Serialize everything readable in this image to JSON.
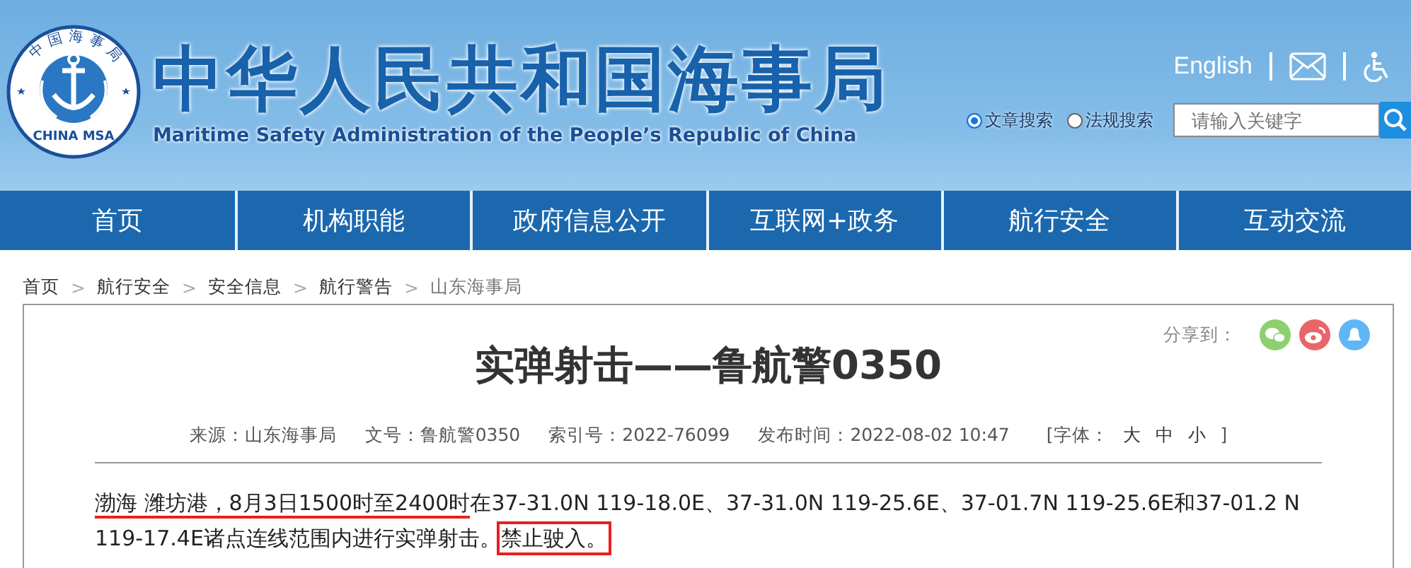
{
  "header": {
    "logo": {
      "ring_text": "中国海事局",
      "bottom_text": "CHINA MSA"
    },
    "title": "中华人民共和国海事局",
    "subtitle": "Maritime Safety Administration of the People’s Republic of China",
    "language_link": "English",
    "search_scopes": [
      {
        "label": "文章搜索",
        "selected": true
      },
      {
        "label": "法规搜索",
        "selected": false
      }
    ],
    "search": {
      "placeholder": "请输入关键字"
    }
  },
  "nav": [
    "首页",
    "机构职能",
    "政府信息公开",
    "互联网+政务",
    "航行安全",
    "互动交流"
  ],
  "breadcrumb": {
    "separator": ">",
    "items": [
      {
        "label": "首页",
        "current": false
      },
      {
        "label": "航行安全",
        "current": false
      },
      {
        "label": "安全信息",
        "current": false
      },
      {
        "label": "航行警告",
        "current": false
      },
      {
        "label": "山东海事局",
        "current": true
      }
    ]
  },
  "article": {
    "share_label": "分享到：",
    "title": "实弹射击——鲁航警0350",
    "meta": [
      "来源：山东海事局",
      "文号：鲁航警0350",
      "索引号：2022-76099",
      "发布时间：2022-08-02 10:47"
    ],
    "font_size": {
      "open": "[字体：",
      "sizes": [
        "大",
        "中",
        "小"
      ],
      "close": "]"
    },
    "body": [
      {
        "kind": "underlined",
        "text": "渤海 潍坊港，8月3日1500时至2400时"
      },
      {
        "kind": "plain",
        "text": "在37-31.0N 119-18.0E、37-31.0N 119-25.6E、37-01.7N 119-25.6E和37-01.2 N 119-17.4E诸点连线范围内进行实弹射击。"
      },
      {
        "kind": "boxed",
        "text": "禁止驶入。"
      }
    ]
  }
}
